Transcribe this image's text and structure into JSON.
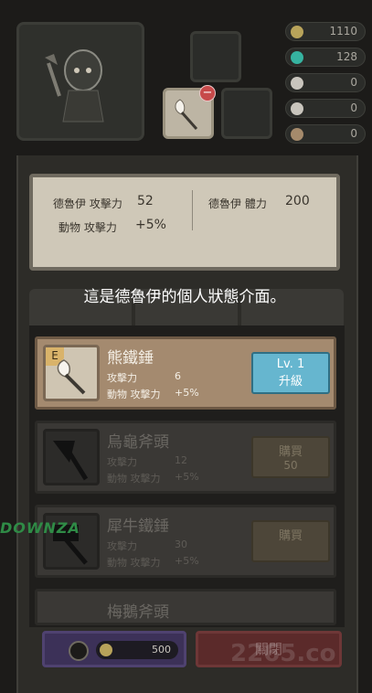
{
  "resources": [
    {
      "icon": "gold-coin-icon",
      "value": "1110",
      "color": "#b8a35a"
    },
    {
      "icon": "gem-icon",
      "value": "128",
      "color": "#36b3a0"
    },
    {
      "icon": "bone-icon",
      "value": "0",
      "color": "#c9c5bd"
    },
    {
      "icon": "fang-icon",
      "value": "0",
      "color": "#c9c5bd"
    },
    {
      "icon": "leaf-icon",
      "value": "0",
      "color": "#a58a6b"
    }
  ],
  "stats": {
    "attack_label": "德魯伊 攻擊力",
    "attack_value": "52",
    "hp_label": "德魯伊 體力",
    "hp_value": "200",
    "animal_label": "動物 攻擊力",
    "animal_value": "+5%"
  },
  "tutorial_text": "這是德魯伊的個人狀態介面。",
  "tabs": [
    {
      "icon": "sword-tab-icon"
    },
    {
      "icon": "leaf-tab-icon"
    },
    {
      "icon": "paw-tab-icon"
    }
  ],
  "items": [
    {
      "rarity": "E",
      "name": "熊鐵錘",
      "attack_label": "攻擊力",
      "attack_value": "6",
      "animal_label": "動物 攻擊力",
      "animal_value": "+5%",
      "button_line1": "Lv. 1",
      "button_line2": "升級"
    },
    {
      "name": "烏龜斧頭",
      "attack_label": "攻擊力",
      "attack_value": "12",
      "animal_label": "動物 攻擊力",
      "animal_value": "+5%",
      "button_line1": "購買",
      "button_line2": "50"
    },
    {
      "name": "犀牛鐵錘",
      "attack_label": "攻擊力",
      "attack_value": "30",
      "animal_label": "動物 攻擊力",
      "animal_value": "+5%",
      "button_line1": "購買"
    },
    {
      "name": "梅鵝斧頭"
    }
  ],
  "bottom": {
    "coin_amount": "500",
    "close_label": "關閉"
  },
  "watermarks": {
    "left": "DOWNZA",
    "right": "2265.co"
  }
}
